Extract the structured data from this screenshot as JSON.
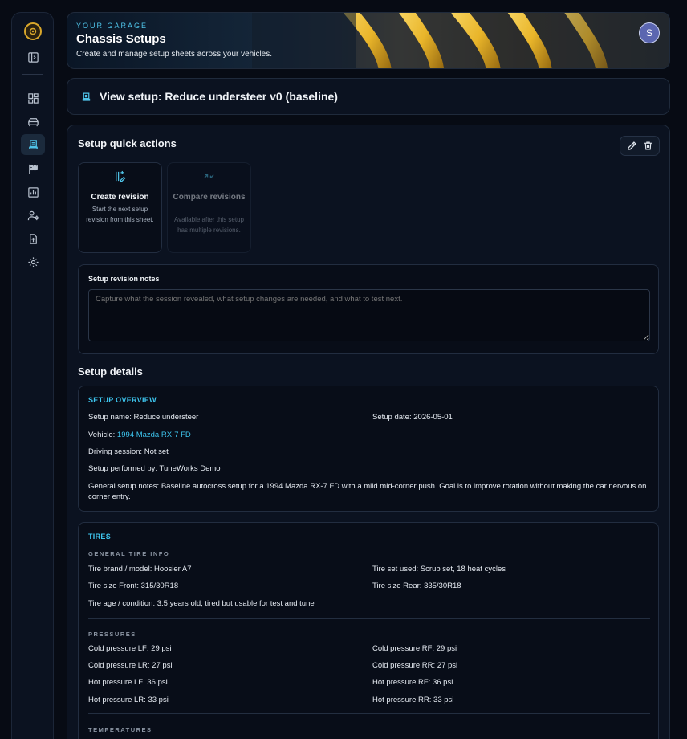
{
  "sidebar": {
    "logo": "gear-logo-icon",
    "items": [
      {
        "icon": "collapse-panel-icon"
      },
      {
        "icon": "dashboard-icon"
      },
      {
        "icon": "car-icon"
      },
      {
        "icon": "setup-sheet-icon",
        "active": true
      },
      {
        "icon": "checkered-flag-icon"
      },
      {
        "icon": "chart-icon"
      },
      {
        "icon": "user-settings-icon"
      },
      {
        "icon": "upload-icon"
      },
      {
        "icon": "gear-icon"
      }
    ]
  },
  "header": {
    "eyebrow": "YOUR GARAGE",
    "title": "Chassis Setups",
    "subtitle": "Create and manage setup sheets across your vehicles.",
    "avatar_initial": "S"
  },
  "view_bar": {
    "title": "View setup: Reduce understeer v0 (baseline)"
  },
  "quick_actions": {
    "title": "Setup quick actions",
    "edit_icon": "pencil-icon",
    "delete_icon": "trash-icon",
    "cards": [
      {
        "title": "Create revision",
        "description": "Start the next setup revision from this sheet.",
        "enabled": true
      },
      {
        "title": "Compare revisions",
        "description": "Available after this setup has multiple revisions.",
        "enabled": false
      }
    ]
  },
  "revision_notes": {
    "label": "Setup revision notes",
    "placeholder": "Capture what the session revealed, what setup changes are needed, and what to test next.",
    "value": ""
  },
  "details": {
    "title": "Setup details",
    "overview": {
      "heading": "SETUP OVERVIEW",
      "name_label": "Setup name:",
      "name_value": "Reduce understeer",
      "date_label": "Setup date:",
      "date_value": "2026-05-01",
      "vehicle_label": "Vehicle:",
      "vehicle_value": "1994 Mazda RX-7 FD",
      "session_label": "Driving session:",
      "session_value": "Not set",
      "performed_label": "Setup performed by:",
      "performed_value": "TuneWorks Demo",
      "notes_label": "General setup notes:",
      "notes_value": "Baseline autocross setup for a 1994 Mazda RX-7 FD with a mild mid-corner push. Goal is to improve rotation without making the car nervous on corner entry."
    },
    "tires": {
      "heading": "TIRES",
      "general_heading": "GENERAL TIRE INFO",
      "general": [
        {
          "label": "Tire brand / model:",
          "value": "Hoosier A7"
        },
        {
          "label": "Tire set used:",
          "value": "Scrub set, 18 heat cycles"
        },
        {
          "label": "Tire size Front:",
          "value": "315/30R18"
        },
        {
          "label": "Tire size Rear:",
          "value": "335/30R18"
        },
        {
          "label": "Tire age / condition:",
          "value": "3.5 years old, tired but usable for test and tune"
        }
      ],
      "pressures_heading": "PRESSURES",
      "pressures": [
        {
          "label": "Cold pressure LF:",
          "value": "29 psi"
        },
        {
          "label": "Cold pressure RF:",
          "value": "29 psi"
        },
        {
          "label": "Cold pressure LR:",
          "value": "27 psi"
        },
        {
          "label": "Cold pressure RR:",
          "value": "27 psi"
        },
        {
          "label": "Hot pressure LF:",
          "value": "36 psi"
        },
        {
          "label": "Hot pressure RF:",
          "value": "36 psi"
        },
        {
          "label": "Hot pressure LR:",
          "value": "33 psi"
        },
        {
          "label": "Hot pressure RR:",
          "value": "33 psi"
        }
      ],
      "temperatures_heading": "TEMPERATURES"
    }
  },
  "colors": {
    "accent": "#3ec6ef",
    "background": "#070b14",
    "panel": "#0b1220",
    "spring_yellow": "#e9b52a"
  }
}
